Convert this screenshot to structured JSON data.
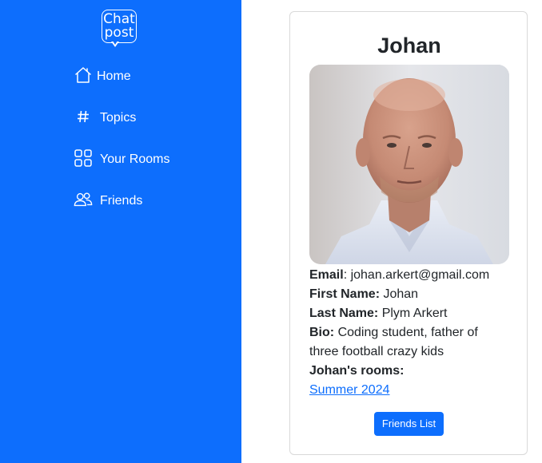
{
  "sidebar": {
    "logo": {
      "line1": "Chat",
      "line2": "post"
    },
    "items": [
      {
        "label": "Home",
        "icon": "house-icon"
      },
      {
        "label": "Topics",
        "icon": "hash-icon"
      },
      {
        "label": "Your Rooms",
        "icon": "grid-icon"
      },
      {
        "label": "Friends",
        "icon": "people-icon"
      }
    ],
    "color": "#0d6efd"
  },
  "profile": {
    "name": "Johan",
    "email_label": "Email",
    "email": "johan.arkert@gmail.com",
    "first_name_label": "First Name:",
    "first_name": "Johan",
    "last_name_label": "Last Name:",
    "last_name": "Plym Arkert",
    "bio_label": "Bio:",
    "bio": "Coding student, father of three football crazy kids",
    "rooms_label": "Johan's rooms:",
    "rooms": [
      "Summer 2024"
    ],
    "friends_button": "Friends List",
    "photo_icon": "profile-photo"
  }
}
